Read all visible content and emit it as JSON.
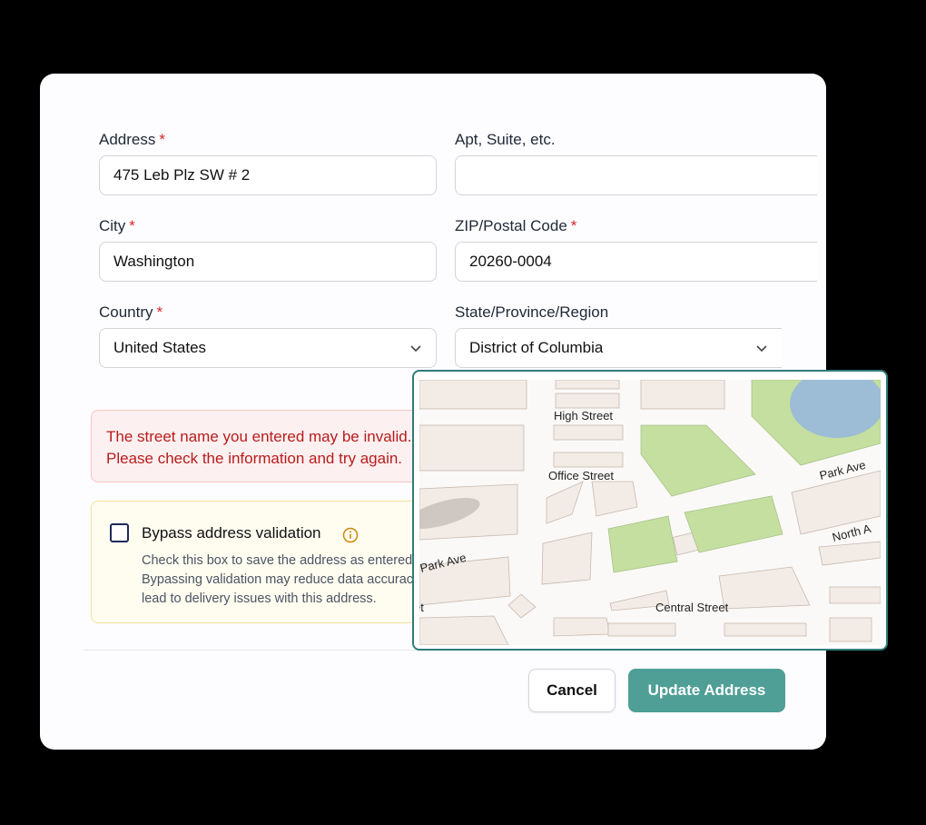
{
  "form": {
    "address": {
      "label": "Address",
      "required": "*",
      "value": "475 Leb Plz SW # 2"
    },
    "apt": {
      "label": "Apt, Suite, etc.",
      "value": ""
    },
    "city": {
      "label": "City",
      "required": "*",
      "value": "Washington"
    },
    "zip": {
      "label": "ZIP/Postal Code",
      "required": "*",
      "value": "20260-0004"
    },
    "country": {
      "label": "Country",
      "required": "*",
      "selected": "United States"
    },
    "state": {
      "label": "State/Province/Region",
      "selected": "District of Columbia"
    }
  },
  "error": {
    "text": "The street name you entered may be invalid. Please check the information and try again."
  },
  "bypass": {
    "title": "Bypass address validation",
    "description": "Check this box to save the address as entered. Bypassing validation may reduce data accuracy and lead to delivery issues with this address.",
    "checked": false
  },
  "buttons": {
    "cancel": "Cancel",
    "update": "Update Address"
  },
  "map": {
    "streets": [
      "High Street",
      "Office Street",
      "Park Ave",
      "North A",
      "Park Ave",
      "Central Street",
      "et"
    ]
  },
  "colors": {
    "accent": "#4f9f97",
    "required": "#dc2626",
    "error_text": "#b91c1c",
    "map_border": "#2f7c78"
  }
}
